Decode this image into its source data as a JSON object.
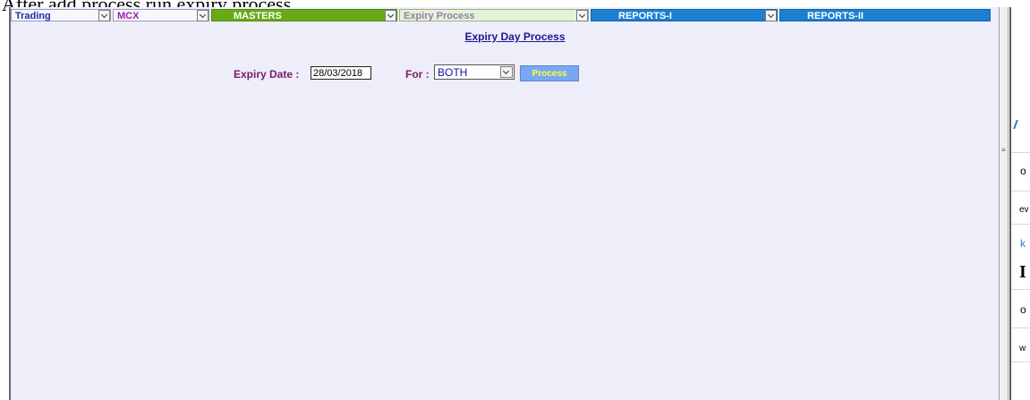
{
  "caption": "After add process run expiry process",
  "menubar": {
    "items": [
      {
        "label": "Trading"
      },
      {
        "label": "MCX"
      },
      {
        "label": "MASTERS"
      },
      {
        "label": "Expiry Process"
      },
      {
        "label": "REPORTS-I"
      },
      {
        "label": "REPORTS-II"
      }
    ]
  },
  "form": {
    "title": "Expiry Day Process",
    "expiry_label": "Expiry Date :",
    "expiry_value": "28/03/2018",
    "for_label": "For :",
    "for_value": "BOTH",
    "process_button": "Process"
  },
  "side_fragments": [
    "o",
    "ev",
    "k",
    "I",
    "o",
    "w"
  ],
  "colors": {
    "page_bg": "#eeeefa",
    "masters_bg": "#6aaa18",
    "reports_bg": "#1c7fd0",
    "expiry_bg": "#e3f3d8",
    "button_bg": "#79a7f2",
    "button_text": "#ffff40"
  }
}
